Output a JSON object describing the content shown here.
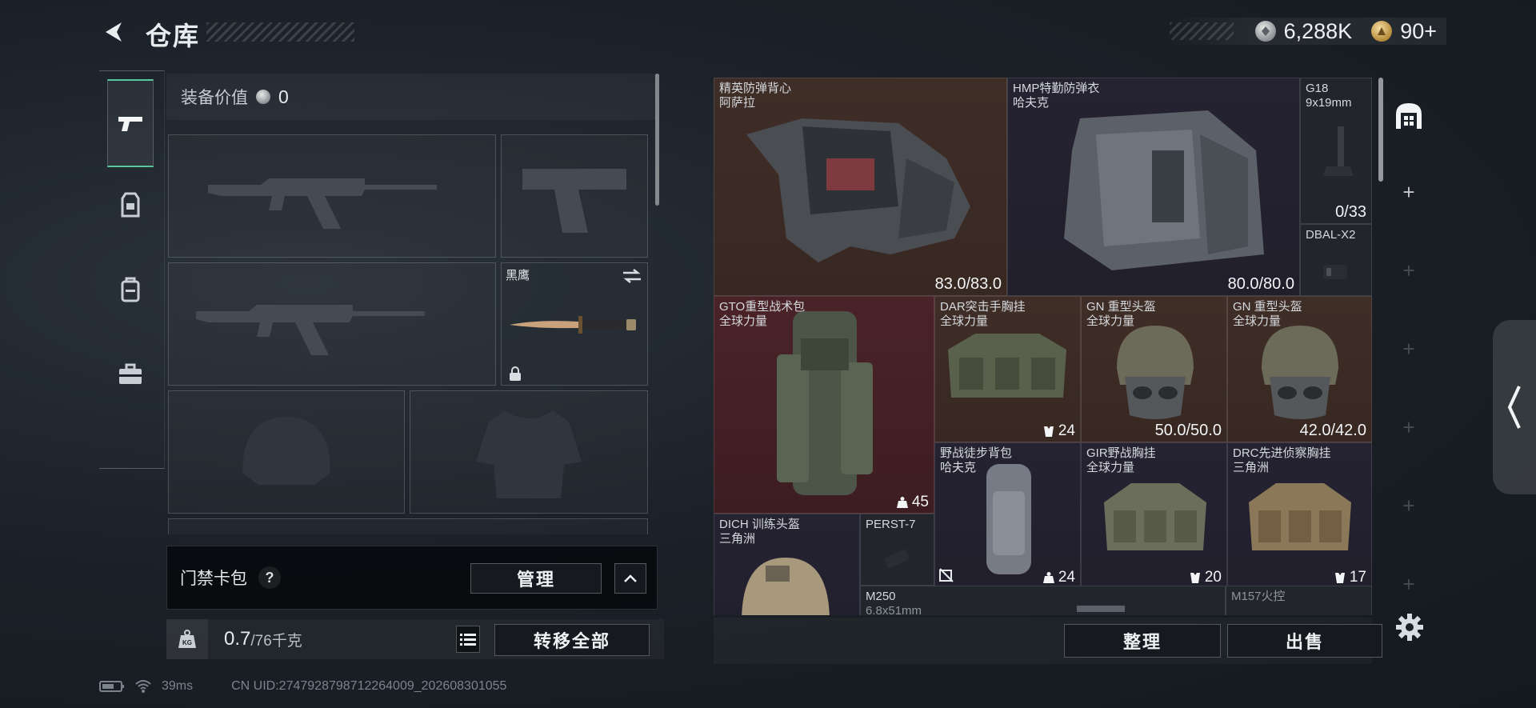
{
  "header": {
    "title": "仓库",
    "silver_amount": "6,288K",
    "gold_amount": "90+"
  },
  "rail": {
    "tabs": [
      {
        "icon": "pistol-icon",
        "active": true
      },
      {
        "icon": "loadout-icon",
        "active": false
      },
      {
        "icon": "backpack-icon",
        "active": false
      },
      {
        "icon": "medkit-icon",
        "active": false
      }
    ]
  },
  "loadout": {
    "equip_value_label": "装备价值",
    "equip_value": "0",
    "melee_name": "黑鹰",
    "access_label": "门禁卡包",
    "help_symbol": "?",
    "manage_label": "管理",
    "weight_current": "0.7",
    "weight_max": "/76千克",
    "transfer_all_label": "转移全部"
  },
  "stash": {
    "items": {
      "vest_elite": {
        "name1": "精英防弹背心",
        "name2": "阿萨拉",
        "value": "83.0/83.0"
      },
      "vest_hmp": {
        "name1": "HMP特勤防弹衣",
        "name2": "哈夫克",
        "value": "80.0/80.0"
      },
      "g18": {
        "name1": "G18",
        "name2": "9x19mm",
        "value": "0/33"
      },
      "dbal": {
        "name1": "DBAL-X2"
      },
      "gto": {
        "name1": "GTO重型战术包",
        "name2": "全球力量",
        "value": "45"
      },
      "dar": {
        "name1": "DAR突击手胸挂",
        "name2": "全球力量",
        "value": "24"
      },
      "gn1": {
        "name1": "GN 重型头盔",
        "name2": "全球力量",
        "value": "50.0/50.0"
      },
      "gn2": {
        "name1": "GN 重型头盔",
        "name2": "全球力量",
        "value": "42.0/42.0"
      },
      "hiking": {
        "name1": "野战徒步背包",
        "name2": "哈夫克",
        "value": "24"
      },
      "gir": {
        "name1": "GIR野战胸挂",
        "name2": "全球力量",
        "value": "20"
      },
      "drc": {
        "name1": "DRC先进侦察胸挂",
        "name2": "三角洲",
        "value": "17"
      },
      "dich": {
        "name1": "DICH 训练头盔",
        "name2": "三角洲"
      },
      "perst": {
        "name1": "PERST-7"
      },
      "m250": {
        "name1": "M250",
        "name2": "6.8x51mm"
      },
      "m157": {
        "name1": "M157火控"
      }
    },
    "sort_label": "整理",
    "sell_label": "出售"
  },
  "status": {
    "ping": "39ms",
    "uid": "CN UID:2747928798712264009_202608301055"
  },
  "colors": {
    "accent_green": "#58c7a0",
    "rarity_brown": "#3f2e27",
    "rarity_red": "#4a2328",
    "rarity_purple": "#252332"
  }
}
